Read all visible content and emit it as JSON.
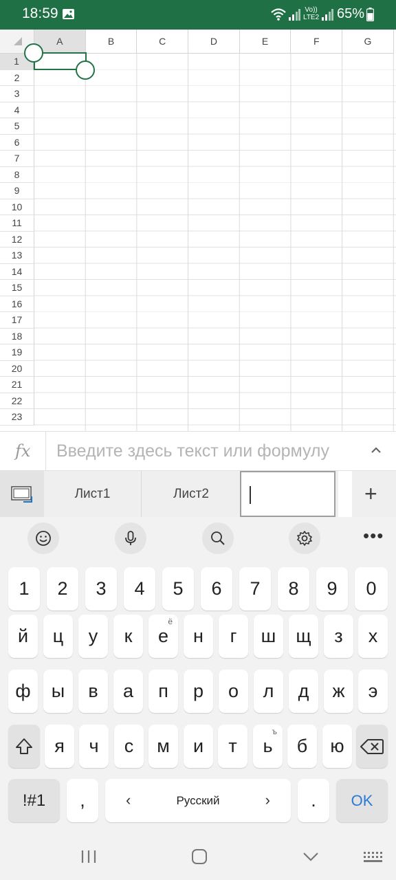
{
  "status_bar": {
    "time": "18:59",
    "lte_top": "Vo))",
    "lte_bottom": "LTE2",
    "battery": "65%",
    "bg_color": "#1f7145"
  },
  "grid": {
    "columns": [
      "A",
      "B",
      "C",
      "D",
      "E",
      "F",
      "G"
    ],
    "rows": [
      "1",
      "2",
      "3",
      "4",
      "5",
      "6",
      "7",
      "8",
      "9",
      "10",
      "11",
      "12",
      "13",
      "14",
      "15",
      "16",
      "17",
      "18",
      "19",
      "20",
      "21",
      "22",
      "23"
    ],
    "selected_cell": "A1",
    "accent_color": "#217346"
  },
  "formula_bar": {
    "icon": "fx",
    "placeholder": "Введите здесь текст или формулу"
  },
  "sheet_tabs": {
    "tabs": [
      "Лист1",
      "Лист2"
    ],
    "new_tab_value": "",
    "add_label": "+"
  },
  "keyboard": {
    "toolbar": [
      "emoji-icon",
      "microphone-icon",
      "search-icon",
      "settings-icon",
      "more-icon"
    ],
    "more_label": "•••",
    "row_numbers": [
      "1",
      "2",
      "3",
      "4",
      "5",
      "6",
      "7",
      "8",
      "9",
      "0"
    ],
    "row1": [
      "й",
      "ц",
      "у",
      "к",
      "е",
      "н",
      "г",
      "ш",
      "щ",
      "з",
      "х"
    ],
    "row1_hint_e": "ё",
    "row2": [
      "ф",
      "ы",
      "в",
      "а",
      "п",
      "р",
      "о",
      "л",
      "д",
      "ж",
      "э"
    ],
    "row3": [
      "я",
      "ч",
      "с",
      "м",
      "и",
      "т",
      "ь",
      "б",
      "ю"
    ],
    "row3_hint_soft": "ъ",
    "symbols_label": "!#1",
    "comma": ",",
    "space_label": "Русский",
    "left_arrow": "‹",
    "right_arrow": "›",
    "period": ".",
    "ok_label": "OK"
  }
}
